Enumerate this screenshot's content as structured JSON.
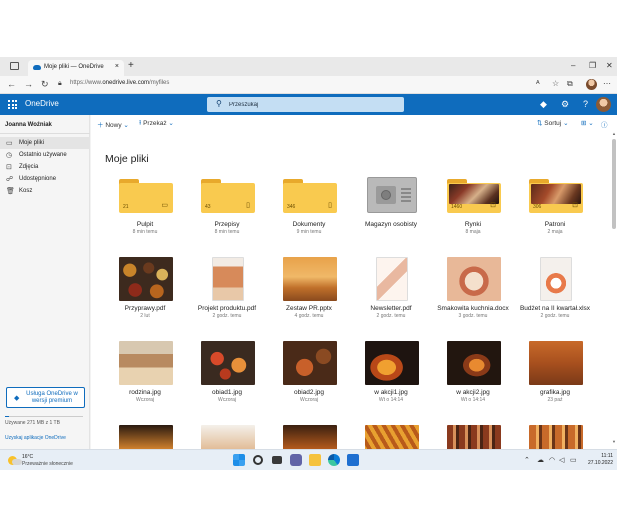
{
  "browser": {
    "tab_title": "Moje pliki — OneDrive",
    "tab_close": "×",
    "new_tab": "+",
    "url_prefix": "https://www.",
    "url_domain": "onedrive.live.com",
    "url_path": "/myfiles",
    "window_controls": [
      "–",
      "❐",
      "✕"
    ]
  },
  "header": {
    "app_name": "OneDrive",
    "search_placeholder": "Przeszukaj"
  },
  "sidebar": {
    "user_name": "Joanna Woźniak",
    "items": [
      {
        "label": "Moje pliki",
        "icon": "folder-icon",
        "active": true
      },
      {
        "label": "Ostatnio używane",
        "icon": "clock-icon",
        "active": false
      },
      {
        "label": "Zdjęcia",
        "icon": "image-icon",
        "active": false
      },
      {
        "label": "Udostępnione",
        "icon": "share-icon",
        "active": false
      },
      {
        "label": "Kosz",
        "icon": "trash-icon",
        "active": false
      }
    ],
    "premium_label": "Usługa OneDrive w wersji premium",
    "storage_text": "Używane 271 MB z 1 TB",
    "storage_fraction": 0.05,
    "get_apps": "Uzyskaj aplikacje OneDrive"
  },
  "commands": {
    "new_label": "Nowy",
    "upload_label": "Przekaż",
    "sort_label": "Sortuj"
  },
  "main": {
    "title": "Moje pliki",
    "rows": [
      [
        {
          "name": "Pulpit",
          "meta": "8 min temu",
          "kind": "folder",
          "count": "21",
          "badge": "monitor-icon"
        },
        {
          "name": "Przepisy",
          "meta": "8 min temu",
          "kind": "folder",
          "count": "43",
          "badge": "document-icon"
        },
        {
          "name": "Dokumenty",
          "meta": "9 min temu",
          "kind": "folder",
          "count": "346",
          "badge": "document-icon"
        },
        {
          "name": "Magazyn osobisty",
          "meta": "",
          "kind": "vault"
        },
        {
          "name": "Rynki",
          "meta": "8 maja",
          "kind": "photo-folder",
          "count": "1460",
          "badge": "image-icon"
        },
        {
          "name": "Patroni",
          "meta": "2 maja",
          "kind": "photo-folder",
          "count": "306",
          "badge": "image-icon"
        }
      ],
      [
        {
          "name": "Przyprawy.pdf",
          "meta": "2 lut",
          "kind": "photo"
        },
        {
          "name": "Projekt produktu.pdf",
          "meta": "2 godz. temu",
          "kind": "doc"
        },
        {
          "name": "Zestaw PR.pptx",
          "meta": "4 godz. temu",
          "kind": "photo"
        },
        {
          "name": "Newsletter.pdf",
          "meta": "2 godz. temu",
          "kind": "doc"
        },
        {
          "name": "Smakowita kuchnia.docx",
          "meta": "3 godz. temu",
          "kind": "doc"
        },
        {
          "name": "Budżet na II kwartał.xlsx",
          "meta": "2 godz. temu",
          "kind": "doc"
        }
      ],
      [
        {
          "name": "rodzina.jpg",
          "meta": "Wczoraj",
          "kind": "photo"
        },
        {
          "name": "obiad1.jpg",
          "meta": "Wczoraj",
          "kind": "photo"
        },
        {
          "name": "obiad2.jpg",
          "meta": "Wczoraj",
          "kind": "photo"
        },
        {
          "name": "w akcji1.jpg",
          "meta": "Wt o 14:14",
          "kind": "photo"
        },
        {
          "name": "w akcji2.jpg",
          "meta": "Wt o 14:14",
          "kind": "photo"
        },
        {
          "name": "grafika.jpg",
          "meta": "23 paź",
          "kind": "photo"
        }
      ]
    ]
  },
  "taskbar": {
    "temperature": "16°C",
    "forecast": "Przeważnie słonecznie",
    "time": "11:11",
    "date": "27.10.2022"
  }
}
